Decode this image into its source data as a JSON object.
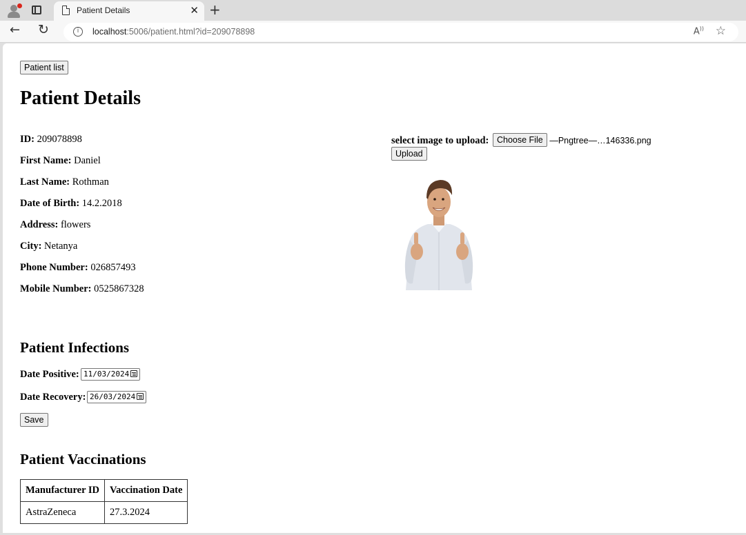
{
  "browser": {
    "tab_title": "Patient Details",
    "url_host": "localhost",
    "url_path": ":5006/patient.html?id=209078898",
    "read_aloud_label": "A̵̅"
  },
  "page": {
    "back_button": "Patient list",
    "title": "Patient Details",
    "fields": [
      {
        "label": "ID:",
        "value": "209078898"
      },
      {
        "label": "First Name:",
        "value": "Daniel"
      },
      {
        "label": "Last Name:",
        "value": "Rothman"
      },
      {
        "label": "Date of Birth:",
        "value": "14.2.2018"
      },
      {
        "label": "Address:",
        "value": "flowers"
      },
      {
        "label": "City:",
        "value": "Netanya"
      },
      {
        "label": "Phone Number:",
        "value": "026857493"
      },
      {
        "label": "Mobile Number:",
        "value": "0525867328"
      }
    ],
    "upload": {
      "label": "select image to upload:",
      "choose_button": "Choose File",
      "file_name": "—Pngtree—…146336.png",
      "upload_button": "Upload"
    },
    "infections": {
      "heading": "Patient Infections",
      "date_positive_label": "Date Positive:",
      "date_positive_value": "11/03/2024",
      "date_recovery_label": "Date Recovery:",
      "date_recovery_value": "26/03/2024",
      "save_button": "Save"
    },
    "vaccinations": {
      "heading": "Patient Vaccinations",
      "columns": [
        "Manufacturer ID",
        "Vaccination Date"
      ],
      "rows": [
        [
          "AstraZeneca",
          "27.3.2024"
        ]
      ]
    }
  }
}
